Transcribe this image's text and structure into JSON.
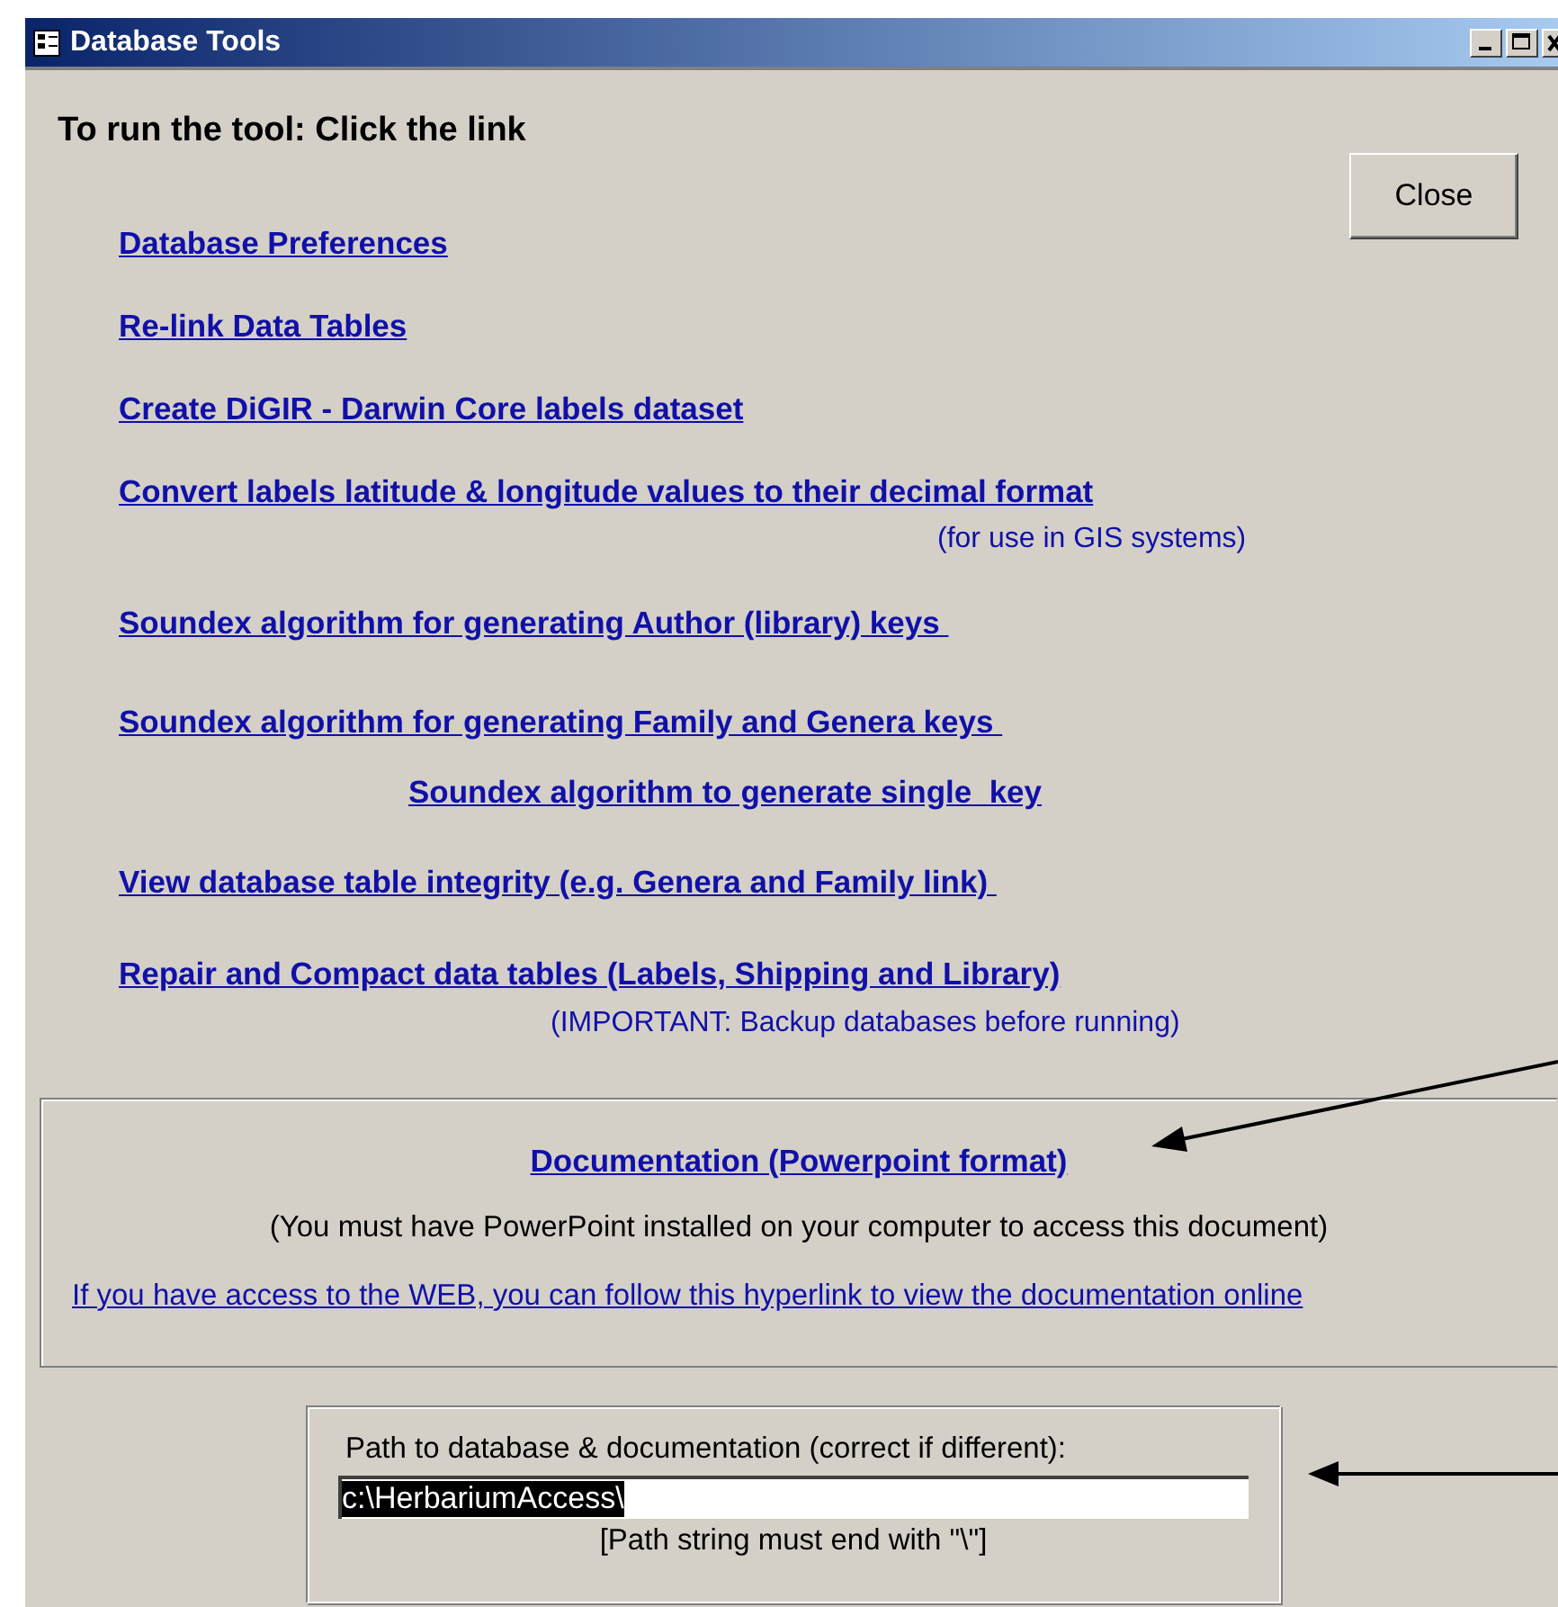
{
  "window": {
    "title": "Database Tools",
    "controls": [
      {
        "kind": "minimize"
      },
      {
        "kind": "maximize"
      },
      {
        "kind": "close"
      }
    ]
  },
  "heading": "To run the tool: Click the link",
  "close_button": "Close",
  "links": [
    {
      "kind": "link",
      "text": "Database Preferences"
    },
    {
      "kind": "link",
      "text": "Re-link Data Tables"
    },
    {
      "kind": "link",
      "text": "Create DiGIR - Darwin Core labels dataset"
    },
    {
      "kind": "link",
      "text": "Convert labels latitude & longitude values to their decimal format",
      "note": "(for use in GIS systems)"
    },
    {
      "kind": "link",
      "text": "Soundex algorithm for generating Author (library) keys "
    },
    {
      "kind": "link",
      "text": "Soundex algorithm for generating Family and Genera keys "
    },
    {
      "kind": "sublink",
      "text": "Soundex algorithm to generate single  key"
    },
    {
      "kind": "link",
      "text": "View database table integrity (e.g. Genera and Family link) "
    },
    {
      "kind": "link",
      "text": "Repair and Compact data tables (Labels, Shipping and Library)",
      "note": "(IMPORTANT: Backup databases before running)"
    }
  ],
  "documentation": {
    "link": "Documentation (Powerpoint format)",
    "note": "(You must have PowerPoint installed on your computer to access this document)",
    "web_link": "If you have access to the WEB, you can follow this hyperlink to view the documentation online"
  },
  "path": {
    "label": "Path to database & documentation (correct if different):",
    "value": "c:\\HerbariumAccess\\",
    "value_selected": true,
    "hint": "[Path string must end with \"\\\"]"
  }
}
